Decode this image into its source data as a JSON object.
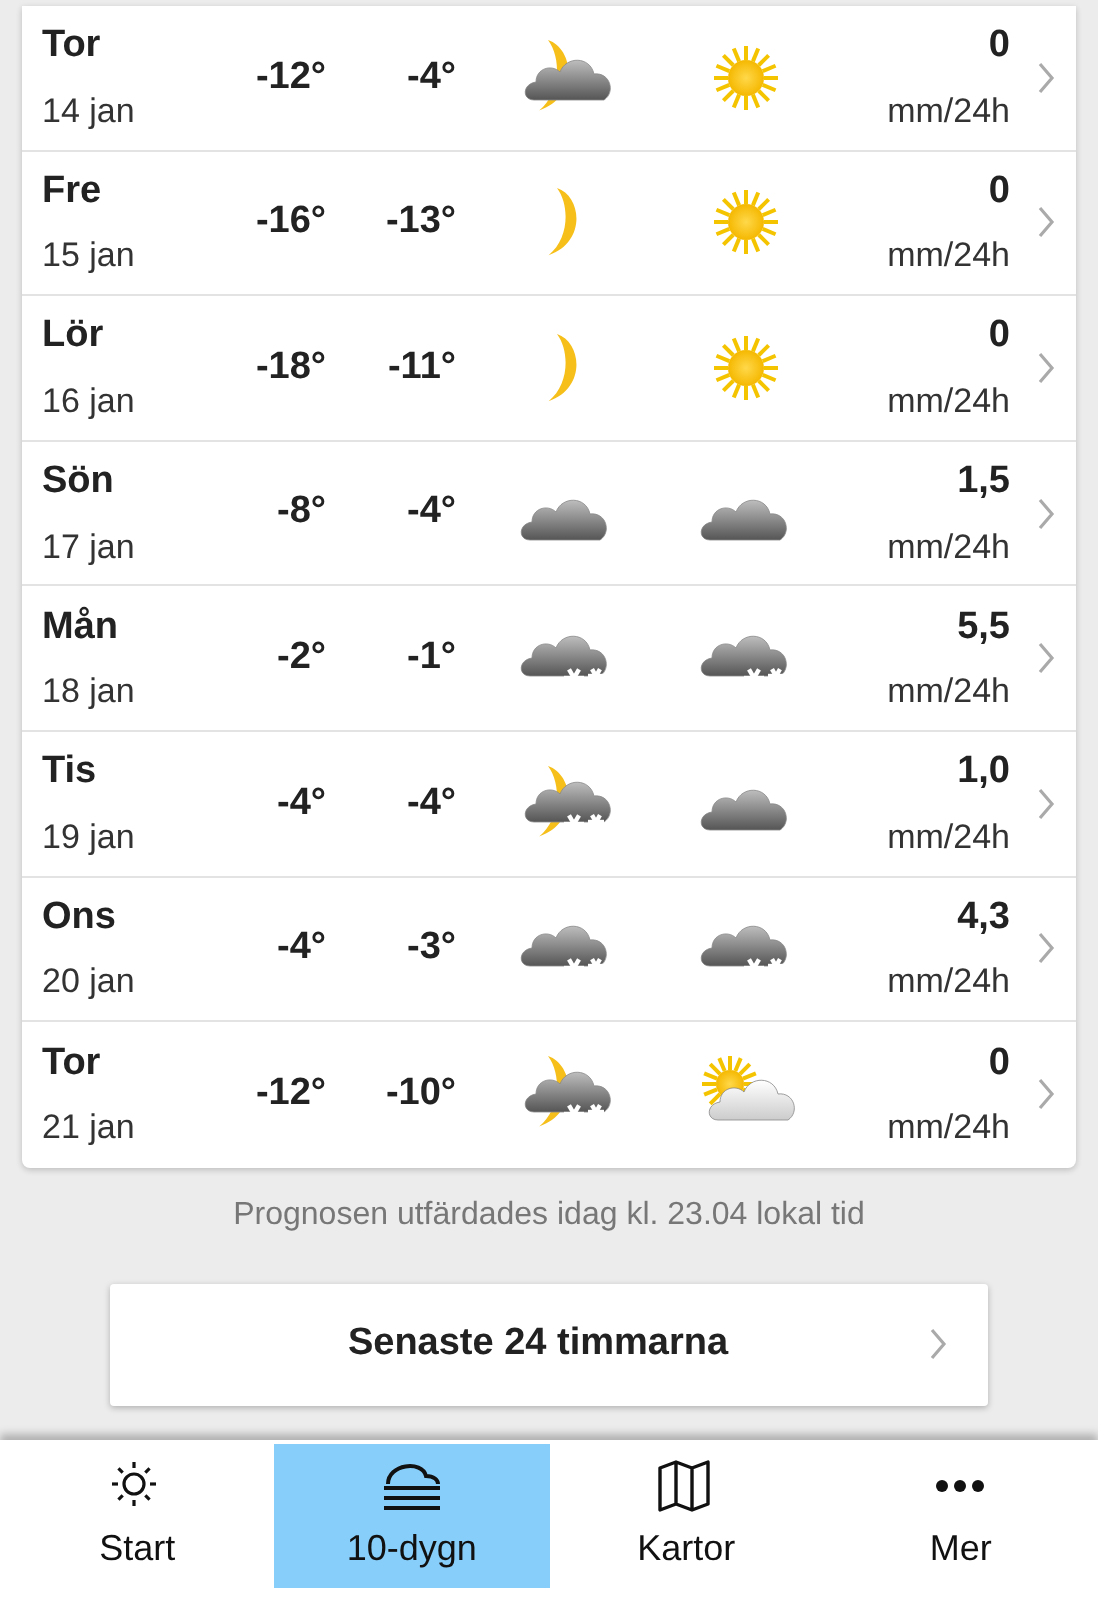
{
  "days": [
    {
      "day": "Tor",
      "date": "14 jan",
      "low": "-12°",
      "high": "-4°",
      "night": {
        "kind": "cloud-moon"
      },
      "daytime": {
        "kind": "sun"
      },
      "precip": "0",
      "unit": "mm/24h"
    },
    {
      "day": "Fre",
      "date": "15 jan",
      "low": "-16°",
      "high": "-13°",
      "night": {
        "kind": "moon"
      },
      "daytime": {
        "kind": "sun"
      },
      "precip": "0",
      "unit": "mm/24h"
    },
    {
      "day": "Lör",
      "date": "16 jan",
      "low": "-18°",
      "high": "-11°",
      "night": {
        "kind": "moon"
      },
      "daytime": {
        "kind": "sun"
      },
      "precip": "0",
      "unit": "mm/24h"
    },
    {
      "day": "Sön",
      "date": "17 jan",
      "low": "-8°",
      "high": "-4°",
      "night": {
        "kind": "cloud"
      },
      "daytime": {
        "kind": "cloud"
      },
      "precip": "1,5",
      "unit": "mm/24h"
    },
    {
      "day": "Mån",
      "date": "18 jan",
      "low": "-2°",
      "high": "-1°",
      "night": {
        "kind": "snow"
      },
      "daytime": {
        "kind": "snow"
      },
      "precip": "5,5",
      "unit": "mm/24h"
    },
    {
      "day": "Tis",
      "date": "19 jan",
      "low": "-4°",
      "high": "-4°",
      "night": {
        "kind": "snowmoon"
      },
      "daytime": {
        "kind": "cloud"
      },
      "precip": "1,0",
      "unit": "mm/24h"
    },
    {
      "day": "Ons",
      "date": "20 jan",
      "low": "-4°",
      "high": "-3°",
      "night": {
        "kind": "snow"
      },
      "daytime": {
        "kind": "snow"
      },
      "precip": "4,3",
      "unit": "mm/24h"
    },
    {
      "day": "Tor",
      "date": "21 jan",
      "low": "-12°",
      "high": "-10°",
      "night": {
        "kind": "snowmoon"
      },
      "daytime": {
        "kind": "suncloud"
      },
      "precip": "0",
      "unit": "mm/24h"
    }
  ],
  "issued": "Prognosen utfärdades idag kl. 23.04 lokal tid",
  "button": "Senaste 24 timmarna",
  "nav": [
    {
      "label": "Start",
      "selected": false
    },
    {
      "label": "10-dygn",
      "selected": true
    },
    {
      "label": "Kartor",
      "selected": false
    },
    {
      "label": "Mer",
      "selected": false
    }
  ]
}
